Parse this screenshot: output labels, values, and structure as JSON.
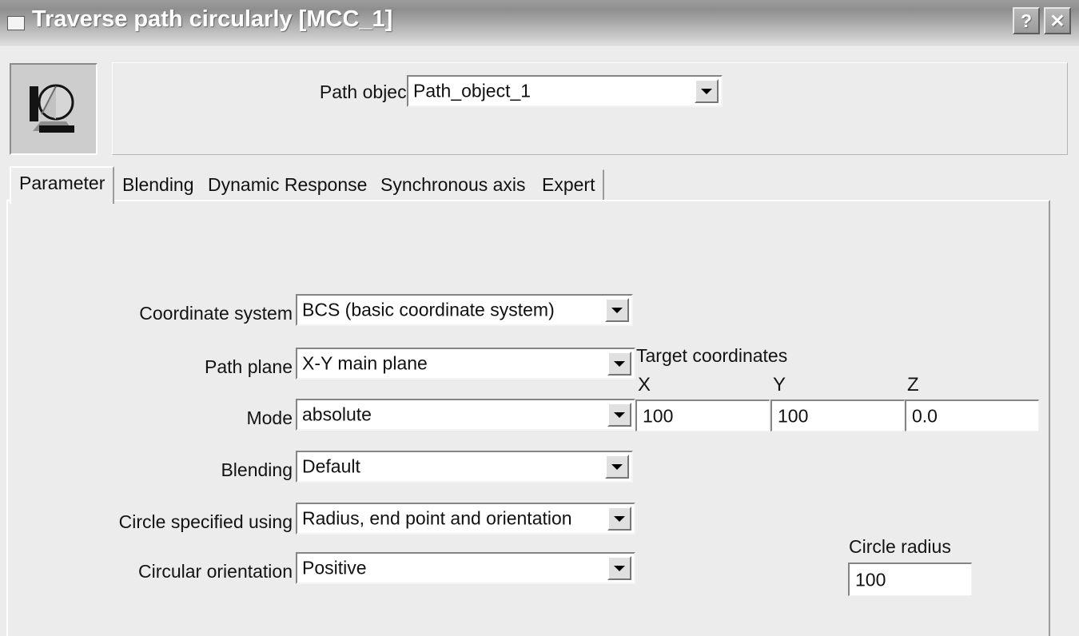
{
  "window": {
    "title": "Traverse path circularly [MCC_1]",
    "icon": "app-square-icon",
    "help_button": "?",
    "close_button": "✕"
  },
  "header": {
    "block_icon": "path-circular-block-icon",
    "path_object": {
      "label": "Path object",
      "value": "Path_object_1",
      "dropdown_icon": "chevron-down-icon"
    }
  },
  "tabs": [
    {
      "label": "Parameter",
      "active": true
    },
    {
      "label": "Blending",
      "active": false
    },
    {
      "label": "Dynamic Response",
      "active": false
    },
    {
      "label": "Synchronous axis",
      "active": false
    },
    {
      "label": "Expert",
      "active": false
    }
  ],
  "parameters": {
    "coordinate_system": {
      "label": "Coordinate system",
      "value": "BCS (basic coordinate system)"
    },
    "path_plane": {
      "label": "Path plane",
      "value": "X-Y main plane"
    },
    "mode": {
      "label": "Mode",
      "value": "absolute"
    },
    "blending": {
      "label": "Blending",
      "value": "Default"
    },
    "circle_specified_using": {
      "label": "Circle specified using",
      "value": "Radius, end point and orientation"
    },
    "circular_orientation": {
      "label": "Circular orientation",
      "value": "Positive"
    }
  },
  "target_coordinates": {
    "group_label": "Target coordinates",
    "x": {
      "label": "X",
      "value": "100"
    },
    "y": {
      "label": "Y",
      "value": "100"
    },
    "z": {
      "label": "Z",
      "value": "0.0"
    }
  },
  "circle_radius": {
    "label": "Circle radius",
    "value": "100"
  },
  "colors": {
    "window_background": "#ececec",
    "field_background": "#ffffff",
    "text": "#111111",
    "titlebar_text": "#ffffff",
    "border_shadow": "#858585",
    "border_highlight": "#ffffff"
  }
}
